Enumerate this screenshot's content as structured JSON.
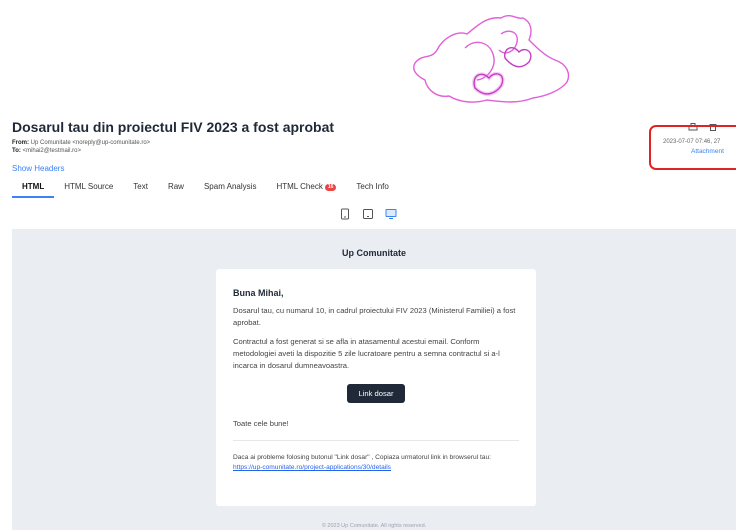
{
  "email": {
    "subject": "Dosarul tau din proiectul FIV 2023 a fost aprobat",
    "from_label": "From:",
    "from_value": "Up Comunitate <noreply@up-comunitate.ro>",
    "to_label": "To:",
    "to_value": "<mihai2@testmail.ro>",
    "show_headers": "Show Headers",
    "date": "2023-07-07 07:46, 27",
    "attachments": "Attachment"
  },
  "tabs": [
    {
      "label": "HTML",
      "active": true
    },
    {
      "label": "HTML Source"
    },
    {
      "label": "Text"
    },
    {
      "label": "Raw"
    },
    {
      "label": "Spam Analysis"
    },
    {
      "label": "HTML Check",
      "badge": "16"
    },
    {
      "label": "Tech Info"
    }
  ],
  "preview": {
    "brand": "Up Comunitate",
    "greeting": "Buna Mihai,",
    "para1": "Dosarul tau, cu numarul 10, in cadrul proiectului FIV 2023 (Ministerul Familiei) a fost aprobat.",
    "para2": "Contractul a fost generat si se afla in atasamentul acestui email. Conform metodologiei aveti la dispozitie   5 zile lucratoare pentru a semna contractul si a-l incarca in dosarul dumneavoastra.",
    "button": "Link dosar",
    "closing": "Toate cele bune!",
    "note": "Daca ai probleme folosing butonul \"Link dosar\" , Copiaza urmatorul link in browserul tau: ",
    "link": "https://up-comunitate.ro/project-applications/30/details",
    "footer": "© 2023 Up Comunitate. All rights reserved."
  },
  "colors": {
    "accent": "#3b82f6",
    "badge": "#ef4444",
    "highlight_box": "#e02424",
    "logo": "#e060d8"
  }
}
